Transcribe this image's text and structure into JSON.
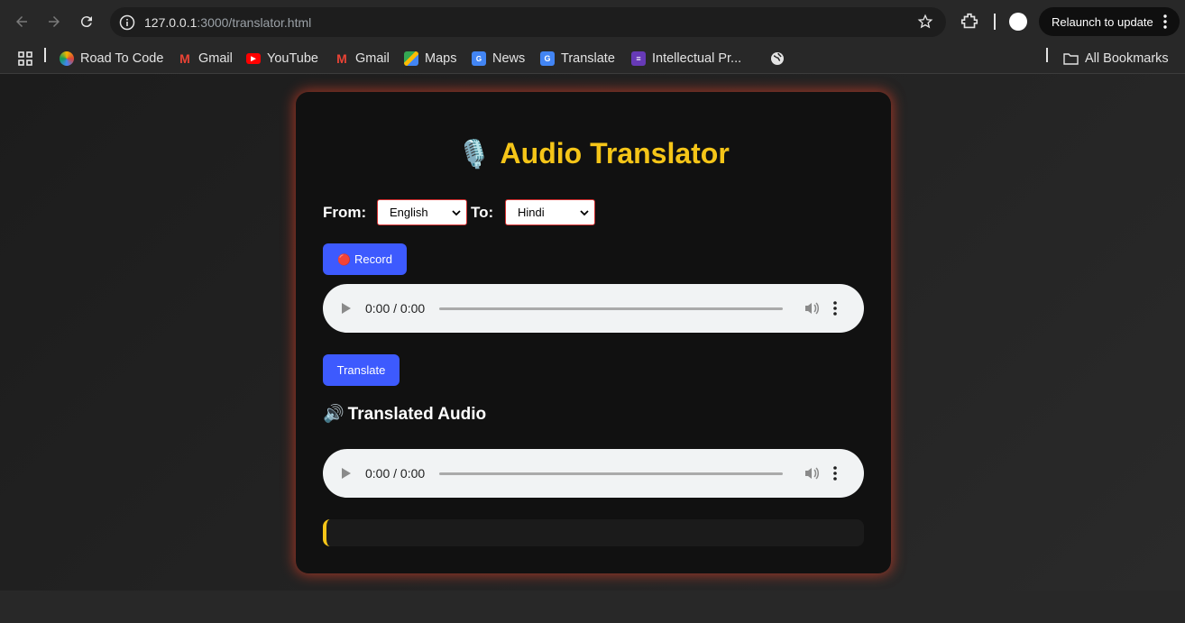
{
  "browser": {
    "url_host": "127.0.0.1",
    "url_path": ":3000/translator.html",
    "relaunch_label": "Relaunch to update",
    "all_bookmarks": "All Bookmarks",
    "bookmarks": [
      {
        "label": "Road To Code"
      },
      {
        "label": "Gmail"
      },
      {
        "label": "YouTube"
      },
      {
        "label": "Gmail"
      },
      {
        "label": "Maps"
      },
      {
        "label": "News"
      },
      {
        "label": "Translate"
      },
      {
        "label": "Intellectual Pr..."
      }
    ]
  },
  "app": {
    "icon": "🎙️",
    "title": "Audio Translator",
    "from_label": "From:",
    "from_value": "English",
    "to_label": "To:",
    "to_value": "Hindi",
    "record_icon": "🔴",
    "record_label": "Record",
    "recorded_time": "0:00 / 0:00",
    "translate_label": "Translate",
    "translated_icon": "🔊",
    "translated_heading": "Translated Audio",
    "translated_time": "0:00 / 0:00",
    "output_text": ""
  },
  "colors": {
    "accent_title": "#f5c518",
    "button": "#3d5afe",
    "select_border": "#d32f2f",
    "card_glow": "#ff4628"
  }
}
